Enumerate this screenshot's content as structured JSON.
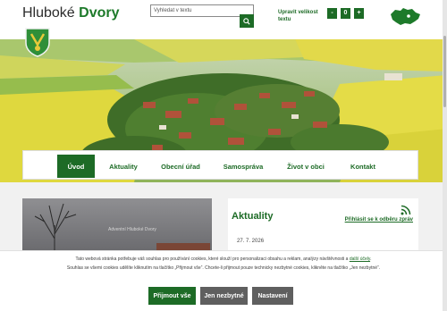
{
  "header": {
    "brand_first": "Hluboké",
    "brand_second": "Dvory",
    "search_placeholder": "Vyhledat v textu",
    "font_size_label": "Upravit velikost textu",
    "font_minus": "-",
    "font_reset": "0",
    "font_plus": "+"
  },
  "nav": {
    "items": [
      {
        "label": "Úvod",
        "active": true
      },
      {
        "label": "Aktuality"
      },
      {
        "label": "Obecní úřad"
      },
      {
        "label": "Samospráva"
      },
      {
        "label": "Život v obci"
      },
      {
        "label": "Kontakt"
      }
    ]
  },
  "photo": {
    "caption": "Adventní Hluboké Dvory"
  },
  "news": {
    "title": "Aktuality",
    "subscribe_link": "Přihlásit se k odběru zpráv",
    "date": "27. 7. 2026"
  },
  "cookie": {
    "line1_prefix": "Tato webová stránka potřebuje váš souhlas pro používání cookies, které slouží pro personalizaci obsahu a reklam, analýzy návštěvnosti a ",
    "line1_link": "další účely",
    "line1_suffix": ".",
    "line2": "Souhlas se všemi cookies udělíte kliknutím na tlačítko „Přijmout vše“. Chcete-li přijmout pouze technicky nezbytné cookies, klikněte na tlačítko „Jen nezbytné“.",
    "accept_all": "Přijmout vše",
    "necessary_only": "Jen nezbytné",
    "settings": "Nastavení"
  },
  "colors": {
    "brand_green": "#1d6b26",
    "field_yellow": "#d9d23a"
  }
}
